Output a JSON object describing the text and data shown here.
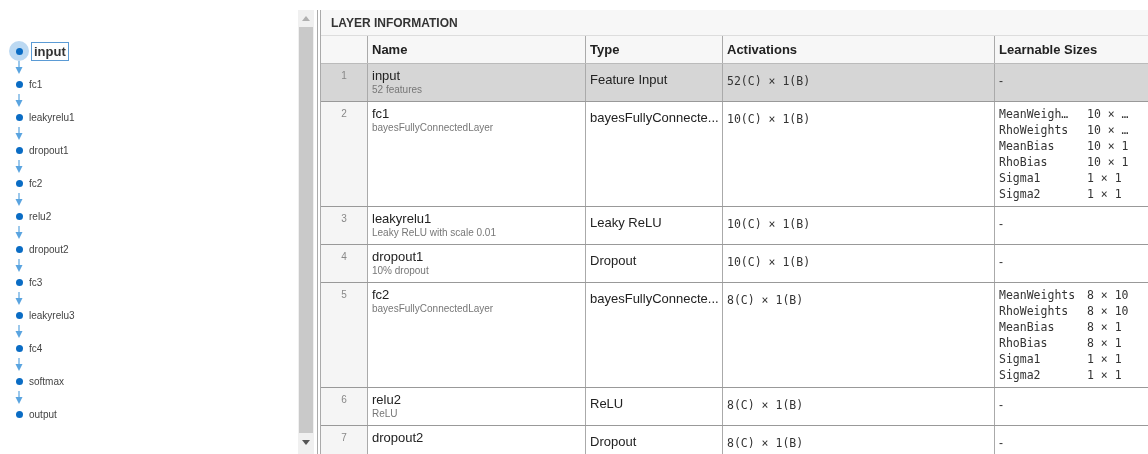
{
  "graph": {
    "nodes": [
      {
        "label": "input",
        "selected": true
      },
      {
        "label": "fc1",
        "selected": false
      },
      {
        "label": "leakyrelu1",
        "selected": false
      },
      {
        "label": "dropout1",
        "selected": false
      },
      {
        "label": "fc2",
        "selected": false
      },
      {
        "label": "relu2",
        "selected": false
      },
      {
        "label": "dropout2",
        "selected": false
      },
      {
        "label": "fc3",
        "selected": false
      },
      {
        "label": "leakyrelu3",
        "selected": false
      },
      {
        "label": "fc4",
        "selected": false
      },
      {
        "label": "softmax",
        "selected": false
      },
      {
        "label": "output",
        "selected": false
      }
    ]
  },
  "layer_information": {
    "title": "LAYER INFORMATION",
    "columns": [
      "Name",
      "Type",
      "Activations",
      "Learnable Sizes"
    ],
    "rows": [
      {
        "index": "1",
        "name": "input",
        "description": "52 features",
        "type": "Feature Input",
        "activations": "52(C) × 1(B)",
        "learnables": "-",
        "selected": true
      },
      {
        "index": "2",
        "name": "fc1",
        "description": "bayesFullyConnectedLayer",
        "type": "bayesFullyConnecte...",
        "activations": "10(C) × 1(B)",
        "learnables": [
          {
            "name": "MeanWeigh…",
            "size": "10 × …"
          },
          {
            "name": "RhoWeights",
            "size": "10 × …"
          },
          {
            "name": "MeanBias",
            "size": "10 × 1"
          },
          {
            "name": "RhoBias",
            "size": "10 × 1"
          },
          {
            "name": "Sigma1",
            "size": "1 × 1"
          },
          {
            "name": "Sigma2",
            "size": "1 × 1"
          }
        ],
        "selected": false
      },
      {
        "index": "3",
        "name": "leakyrelu1",
        "description": "Leaky ReLU with scale 0.01",
        "type": "Leaky ReLU",
        "activations": "10(C) × 1(B)",
        "learnables": "-",
        "selected": false
      },
      {
        "index": "4",
        "name": "dropout1",
        "description": "10% dropout",
        "type": "Dropout",
        "activations": "10(C) × 1(B)",
        "learnables": "-",
        "selected": false
      },
      {
        "index": "5",
        "name": "fc2",
        "description": "bayesFullyConnectedLayer",
        "type": "bayesFullyConnecte...",
        "activations": "8(C) × 1(B)",
        "learnables": [
          {
            "name": "MeanWeights",
            "size": "8 × 10"
          },
          {
            "name": "RhoWeights",
            "size": "8 × 10"
          },
          {
            "name": "MeanBias",
            "size": "8 × 1"
          },
          {
            "name": "RhoBias",
            "size": "8 × 1"
          },
          {
            "name": "Sigma1",
            "size": "1 × 1"
          },
          {
            "name": "Sigma2",
            "size": "1 × 1"
          }
        ],
        "selected": false
      },
      {
        "index": "6",
        "name": "relu2",
        "description": "ReLU",
        "type": "ReLU",
        "activations": "8(C) × 1(B)",
        "learnables": "-",
        "selected": false
      },
      {
        "index": "7",
        "name": "dropout2",
        "type": "Dropout",
        "activations": "8(C) × 1(B)",
        "learnables": "-",
        "selected": false
      }
    ]
  }
}
